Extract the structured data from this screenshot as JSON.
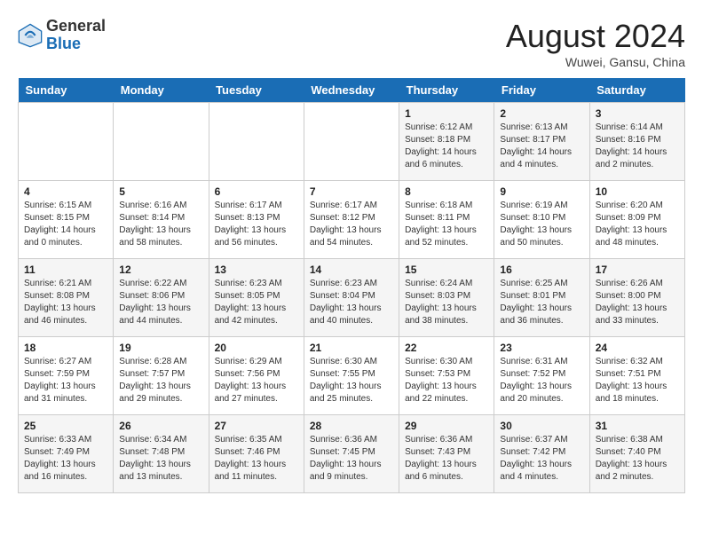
{
  "header": {
    "logo_general": "General",
    "logo_blue": "Blue",
    "month_title": "August 2024",
    "subtitle": "Wuwei, Gansu, China"
  },
  "days_of_week": [
    "Sunday",
    "Monday",
    "Tuesday",
    "Wednesday",
    "Thursday",
    "Friday",
    "Saturday"
  ],
  "weeks": [
    [
      {
        "day": "",
        "info": ""
      },
      {
        "day": "",
        "info": ""
      },
      {
        "day": "",
        "info": ""
      },
      {
        "day": "",
        "info": ""
      },
      {
        "day": "1",
        "info": "Sunrise: 6:12 AM\nSunset: 8:18 PM\nDaylight: 14 hours\nand 6 minutes."
      },
      {
        "day": "2",
        "info": "Sunrise: 6:13 AM\nSunset: 8:17 PM\nDaylight: 14 hours\nand 4 minutes."
      },
      {
        "day": "3",
        "info": "Sunrise: 6:14 AM\nSunset: 8:16 PM\nDaylight: 14 hours\nand 2 minutes."
      }
    ],
    [
      {
        "day": "4",
        "info": "Sunrise: 6:15 AM\nSunset: 8:15 PM\nDaylight: 14 hours\nand 0 minutes."
      },
      {
        "day": "5",
        "info": "Sunrise: 6:16 AM\nSunset: 8:14 PM\nDaylight: 13 hours\nand 58 minutes."
      },
      {
        "day": "6",
        "info": "Sunrise: 6:17 AM\nSunset: 8:13 PM\nDaylight: 13 hours\nand 56 minutes."
      },
      {
        "day": "7",
        "info": "Sunrise: 6:17 AM\nSunset: 8:12 PM\nDaylight: 13 hours\nand 54 minutes."
      },
      {
        "day": "8",
        "info": "Sunrise: 6:18 AM\nSunset: 8:11 PM\nDaylight: 13 hours\nand 52 minutes."
      },
      {
        "day": "9",
        "info": "Sunrise: 6:19 AM\nSunset: 8:10 PM\nDaylight: 13 hours\nand 50 minutes."
      },
      {
        "day": "10",
        "info": "Sunrise: 6:20 AM\nSunset: 8:09 PM\nDaylight: 13 hours\nand 48 minutes."
      }
    ],
    [
      {
        "day": "11",
        "info": "Sunrise: 6:21 AM\nSunset: 8:08 PM\nDaylight: 13 hours\nand 46 minutes."
      },
      {
        "day": "12",
        "info": "Sunrise: 6:22 AM\nSunset: 8:06 PM\nDaylight: 13 hours\nand 44 minutes."
      },
      {
        "day": "13",
        "info": "Sunrise: 6:23 AM\nSunset: 8:05 PM\nDaylight: 13 hours\nand 42 minutes."
      },
      {
        "day": "14",
        "info": "Sunrise: 6:23 AM\nSunset: 8:04 PM\nDaylight: 13 hours\nand 40 minutes."
      },
      {
        "day": "15",
        "info": "Sunrise: 6:24 AM\nSunset: 8:03 PM\nDaylight: 13 hours\nand 38 minutes."
      },
      {
        "day": "16",
        "info": "Sunrise: 6:25 AM\nSunset: 8:01 PM\nDaylight: 13 hours\nand 36 minutes."
      },
      {
        "day": "17",
        "info": "Sunrise: 6:26 AM\nSunset: 8:00 PM\nDaylight: 13 hours\nand 33 minutes."
      }
    ],
    [
      {
        "day": "18",
        "info": "Sunrise: 6:27 AM\nSunset: 7:59 PM\nDaylight: 13 hours\nand 31 minutes."
      },
      {
        "day": "19",
        "info": "Sunrise: 6:28 AM\nSunset: 7:57 PM\nDaylight: 13 hours\nand 29 minutes."
      },
      {
        "day": "20",
        "info": "Sunrise: 6:29 AM\nSunset: 7:56 PM\nDaylight: 13 hours\nand 27 minutes."
      },
      {
        "day": "21",
        "info": "Sunrise: 6:30 AM\nSunset: 7:55 PM\nDaylight: 13 hours\nand 25 minutes."
      },
      {
        "day": "22",
        "info": "Sunrise: 6:30 AM\nSunset: 7:53 PM\nDaylight: 13 hours\nand 22 minutes."
      },
      {
        "day": "23",
        "info": "Sunrise: 6:31 AM\nSunset: 7:52 PM\nDaylight: 13 hours\nand 20 minutes."
      },
      {
        "day": "24",
        "info": "Sunrise: 6:32 AM\nSunset: 7:51 PM\nDaylight: 13 hours\nand 18 minutes."
      }
    ],
    [
      {
        "day": "25",
        "info": "Sunrise: 6:33 AM\nSunset: 7:49 PM\nDaylight: 13 hours\nand 16 minutes."
      },
      {
        "day": "26",
        "info": "Sunrise: 6:34 AM\nSunset: 7:48 PM\nDaylight: 13 hours\nand 13 minutes."
      },
      {
        "day": "27",
        "info": "Sunrise: 6:35 AM\nSunset: 7:46 PM\nDaylight: 13 hours\nand 11 minutes."
      },
      {
        "day": "28",
        "info": "Sunrise: 6:36 AM\nSunset: 7:45 PM\nDaylight: 13 hours\nand 9 minutes."
      },
      {
        "day": "29",
        "info": "Sunrise: 6:36 AM\nSunset: 7:43 PM\nDaylight: 13 hours\nand 6 minutes."
      },
      {
        "day": "30",
        "info": "Sunrise: 6:37 AM\nSunset: 7:42 PM\nDaylight: 13 hours\nand 4 minutes."
      },
      {
        "day": "31",
        "info": "Sunrise: 6:38 AM\nSunset: 7:40 PM\nDaylight: 13 hours\nand 2 minutes."
      }
    ]
  ]
}
